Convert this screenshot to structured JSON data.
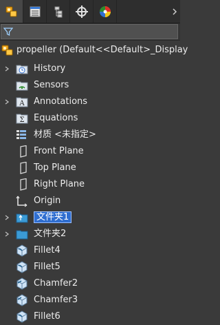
{
  "tabs": [
    {
      "name": "feature-manager-tab",
      "icon": "feature-tree-icon",
      "active": true
    },
    {
      "name": "property-manager-tab",
      "icon": "property-sheet-icon",
      "active": false
    },
    {
      "name": "configuration-manager-tab",
      "icon": "configuration-icon",
      "active": false
    },
    {
      "name": "dimxpert-tab",
      "icon": "crosshair-icon",
      "active": false
    },
    {
      "name": "display-manager-tab",
      "icon": "display-pie-icon",
      "active": false
    }
  ],
  "filter": {
    "icon": "filter-icon"
  },
  "tree": {
    "root": {
      "label": "propeller  (Default<<Default>_Display",
      "icon": "part-icon"
    },
    "items": [
      {
        "label": "History",
        "icon": "history-folder-icon",
        "expandable": true
      },
      {
        "label": "Sensors",
        "icon": "sensors-folder-icon",
        "expandable": false
      },
      {
        "label": "Annotations",
        "icon": "annotations-icon",
        "expandable": true
      },
      {
        "label": "Equations",
        "icon": "equations-icon",
        "expandable": false
      },
      {
        "label": "材质 <未指定>",
        "icon": "material-icon",
        "expandable": false
      },
      {
        "label": "Front Plane",
        "icon": "plane-icon",
        "expandable": false
      },
      {
        "label": "Top Plane",
        "icon": "plane-icon",
        "expandable": false
      },
      {
        "label": "Right Plane",
        "icon": "plane-icon",
        "expandable": false
      },
      {
        "label": "Origin",
        "icon": "origin-icon",
        "expandable": false
      },
      {
        "label": "文件夹1",
        "icon": "folder-icon",
        "expandable": true,
        "selected": true
      },
      {
        "label": "文件夹2",
        "icon": "folder-icon",
        "expandable": true
      },
      {
        "label": "Fillet4",
        "icon": "fillet-icon",
        "expandable": false
      },
      {
        "label": "Fillet5",
        "icon": "fillet-icon",
        "expandable": false
      },
      {
        "label": "Chamfer2",
        "icon": "chamfer-icon",
        "expandable": false
      },
      {
        "label": "Chamfer3",
        "icon": "chamfer-icon",
        "expandable": false
      },
      {
        "label": "Fillet6",
        "icon": "fillet-icon",
        "expandable": false
      }
    ]
  },
  "colors": {
    "selection": "#2f6ed0",
    "background": "#3a3a3a"
  }
}
